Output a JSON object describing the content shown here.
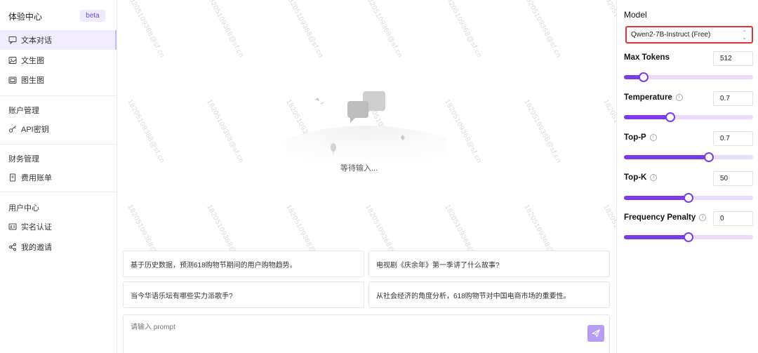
{
  "sidebar": {
    "brand": "体验中心",
    "badge": "beta",
    "items": [
      {
        "label": "文本对话",
        "icon": "chat-icon",
        "active": true
      },
      {
        "label": "文生图",
        "icon": "image-icon"
      },
      {
        "label": "图生图",
        "icon": "images-icon"
      }
    ],
    "sections": [
      {
        "title": "账户管理",
        "items": [
          {
            "label": "API密钥",
            "icon": "key-icon"
          }
        ]
      },
      {
        "title": "财务管理",
        "items": [
          {
            "label": "费用账单",
            "icon": "bill-icon"
          }
        ]
      },
      {
        "title": "用户中心",
        "items": [
          {
            "label": "实名认证",
            "icon": "id-card-icon"
          },
          {
            "label": "我的邀请",
            "icon": "share-icon"
          }
        ]
      }
    ]
  },
  "main": {
    "empty_text": "等待输入...",
    "watermark": "18205109368@sf.cn",
    "suggestions": [
      "基于历史数据，预测618购物节期间的用户购物趋势。",
      "电视剧《庆余年》第一季讲了什么故事?",
      "当今华语乐坛有哪些实力派歌手?",
      "从社会经济的角度分析，618购物节对中国电商市场的重要性。"
    ],
    "prompt_placeholder": "请输入 prompt"
  },
  "panel": {
    "model_label": "Model",
    "model_value": "Qwen2-7B-Instruct (Free)",
    "params": [
      {
        "label": "Max Tokens",
        "value": "512",
        "info": false,
        "level": 0.15
      },
      {
        "label": "Temperature",
        "value": "0.7",
        "info": true,
        "level": 0.36
      },
      {
        "label": "Top-P",
        "value": "0.7",
        "info": true,
        "level": 0.66
      },
      {
        "label": "Top-K",
        "value": "50",
        "info": true,
        "level": 0.5
      },
      {
        "label": "Frequency Penalty",
        "value": "0",
        "info": true,
        "level": 0.5
      }
    ]
  },
  "colors": {
    "accent": "#7c3aed",
    "track": "#e9dcfb",
    "highlight": "#e03434"
  }
}
